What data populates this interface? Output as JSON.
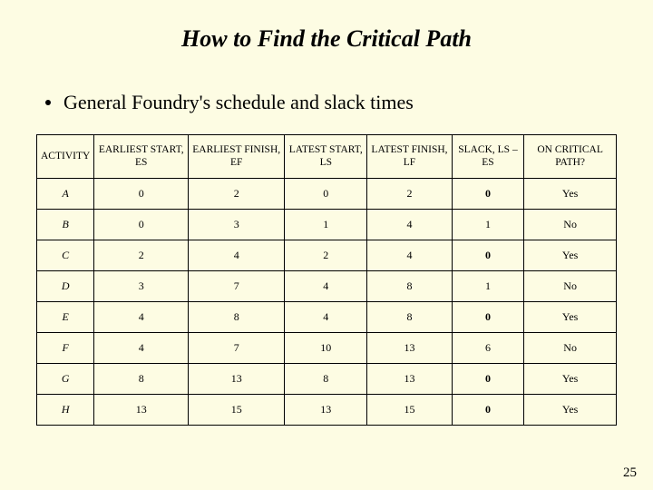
{
  "title": "How to Find the Critical Path",
  "bullet": "General Foundry's schedule and slack times",
  "headers": {
    "activity": "ACTIVITY",
    "es": "EARLIEST START, ES",
    "ef": "EARLIEST FINISH, EF",
    "ls": "LATEST START, LS",
    "lf": "LATEST FINISH, LF",
    "slack": "SLACK, LS – ES",
    "oncp": "ON CRITICAL PATH?"
  },
  "rows": [
    {
      "act": "A",
      "es": "0",
      "ef": "2",
      "ls": "0",
      "lf": "2",
      "slack": "0",
      "oncp": "Yes",
      "zero": true
    },
    {
      "act": "B",
      "es": "0",
      "ef": "3",
      "ls": "1",
      "lf": "4",
      "slack": "1",
      "oncp": "No",
      "zero": false
    },
    {
      "act": "C",
      "es": "2",
      "ef": "4",
      "ls": "2",
      "lf": "4",
      "slack": "0",
      "oncp": "Yes",
      "zero": true
    },
    {
      "act": "D",
      "es": "3",
      "ef": "7",
      "ls": "4",
      "lf": "8",
      "slack": "1",
      "oncp": "No",
      "zero": false
    },
    {
      "act": "E",
      "es": "4",
      "ef": "8",
      "ls": "4",
      "lf": "8",
      "slack": "0",
      "oncp": "Yes",
      "zero": true
    },
    {
      "act": "F",
      "es": "4",
      "ef": "7",
      "ls": "10",
      "lf": "13",
      "slack": "6",
      "oncp": "No",
      "zero": false
    },
    {
      "act": "G",
      "es": "8",
      "ef": "13",
      "ls": "8",
      "lf": "13",
      "slack": "0",
      "oncp": "Yes",
      "zero": true
    },
    {
      "act": "H",
      "es": "13",
      "ef": "15",
      "ls": "13",
      "lf": "15",
      "slack": "0",
      "oncp": "Yes",
      "zero": true
    }
  ],
  "page_number": "25",
  "chart_data": {
    "type": "table",
    "title": "General Foundry's schedule and slack times",
    "columns": [
      "ACTIVITY",
      "EARLIEST START, ES",
      "EARLIEST FINISH, EF",
      "LATEST START, LS",
      "LATEST FINISH, LF",
      "SLACK, LS – ES",
      "ON CRITICAL PATH?"
    ],
    "data": [
      [
        "A",
        0,
        2,
        0,
        2,
        0,
        "Yes"
      ],
      [
        "B",
        0,
        3,
        1,
        4,
        1,
        "No"
      ],
      [
        "C",
        2,
        4,
        2,
        4,
        0,
        "Yes"
      ],
      [
        "D",
        3,
        7,
        4,
        8,
        1,
        "No"
      ],
      [
        "E",
        4,
        8,
        4,
        8,
        0,
        "Yes"
      ],
      [
        "F",
        4,
        7,
        10,
        13,
        6,
        "No"
      ],
      [
        "G",
        8,
        13,
        8,
        13,
        0,
        "Yes"
      ],
      [
        "H",
        13,
        15,
        13,
        15,
        0,
        "Yes"
      ]
    ]
  }
}
